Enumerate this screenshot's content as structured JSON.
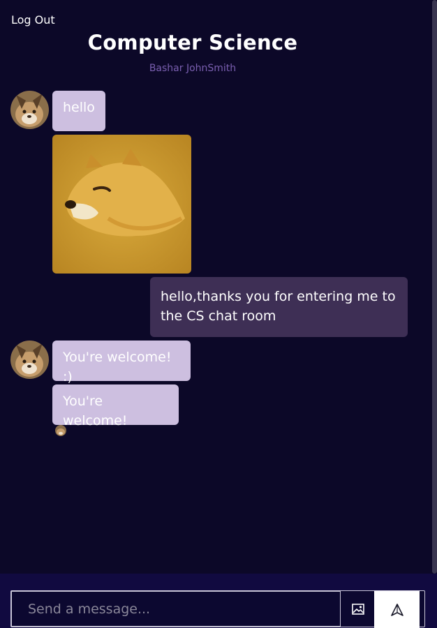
{
  "header": {
    "logout_label": "Log Out",
    "room_title": "Computer Science",
    "room_users": "Bashar JohnSmith"
  },
  "messages": [
    {
      "direction": "incoming",
      "type": "text",
      "text": "hello"
    },
    {
      "direction": "incoming",
      "type": "image",
      "image_subject": "shiba-inu-dog-image"
    },
    {
      "direction": "outgoing",
      "type": "text",
      "text": "hello,thanks you for entering me to the CS chat room"
    },
    {
      "direction": "incoming",
      "type": "text",
      "text": "You're welcome! :)"
    },
    {
      "direction": "incoming",
      "type": "text",
      "text": "You're welcome!"
    }
  ],
  "composer": {
    "placeholder": "Send a message...",
    "value": "",
    "image_icon": "image-icon",
    "send_icon": "send-icon"
  },
  "colors": {
    "background": "#0c0828",
    "incoming_bubble": "#cdbfe0",
    "outgoing_bubble": "#3e2f55",
    "users_text": "#7a5fb0",
    "composer_bar": "#110a40"
  }
}
